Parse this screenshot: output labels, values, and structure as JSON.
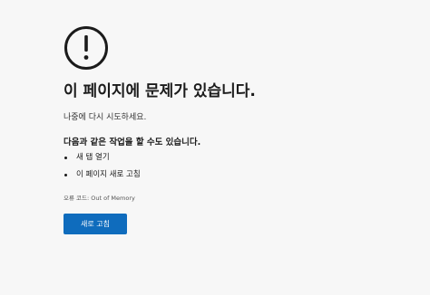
{
  "error_icon": "exclamation-circle-icon",
  "title": "이 페이지에 문제가 있습니다.",
  "subtitle": "나중에 다시 시도하세요.",
  "actions_heading": "다음과 같은 작업을 할 수도 있습니다.",
  "actions": [
    "새 탭 열기",
    "이 페이지 새로 고침"
  ],
  "error_code_text": "오류 코드: Out of Memory",
  "reload_button_label": "새로 고침",
  "colors": {
    "background": "#f7f7f7",
    "accent": "#0f6cbd",
    "text": "#1b1b1b"
  }
}
